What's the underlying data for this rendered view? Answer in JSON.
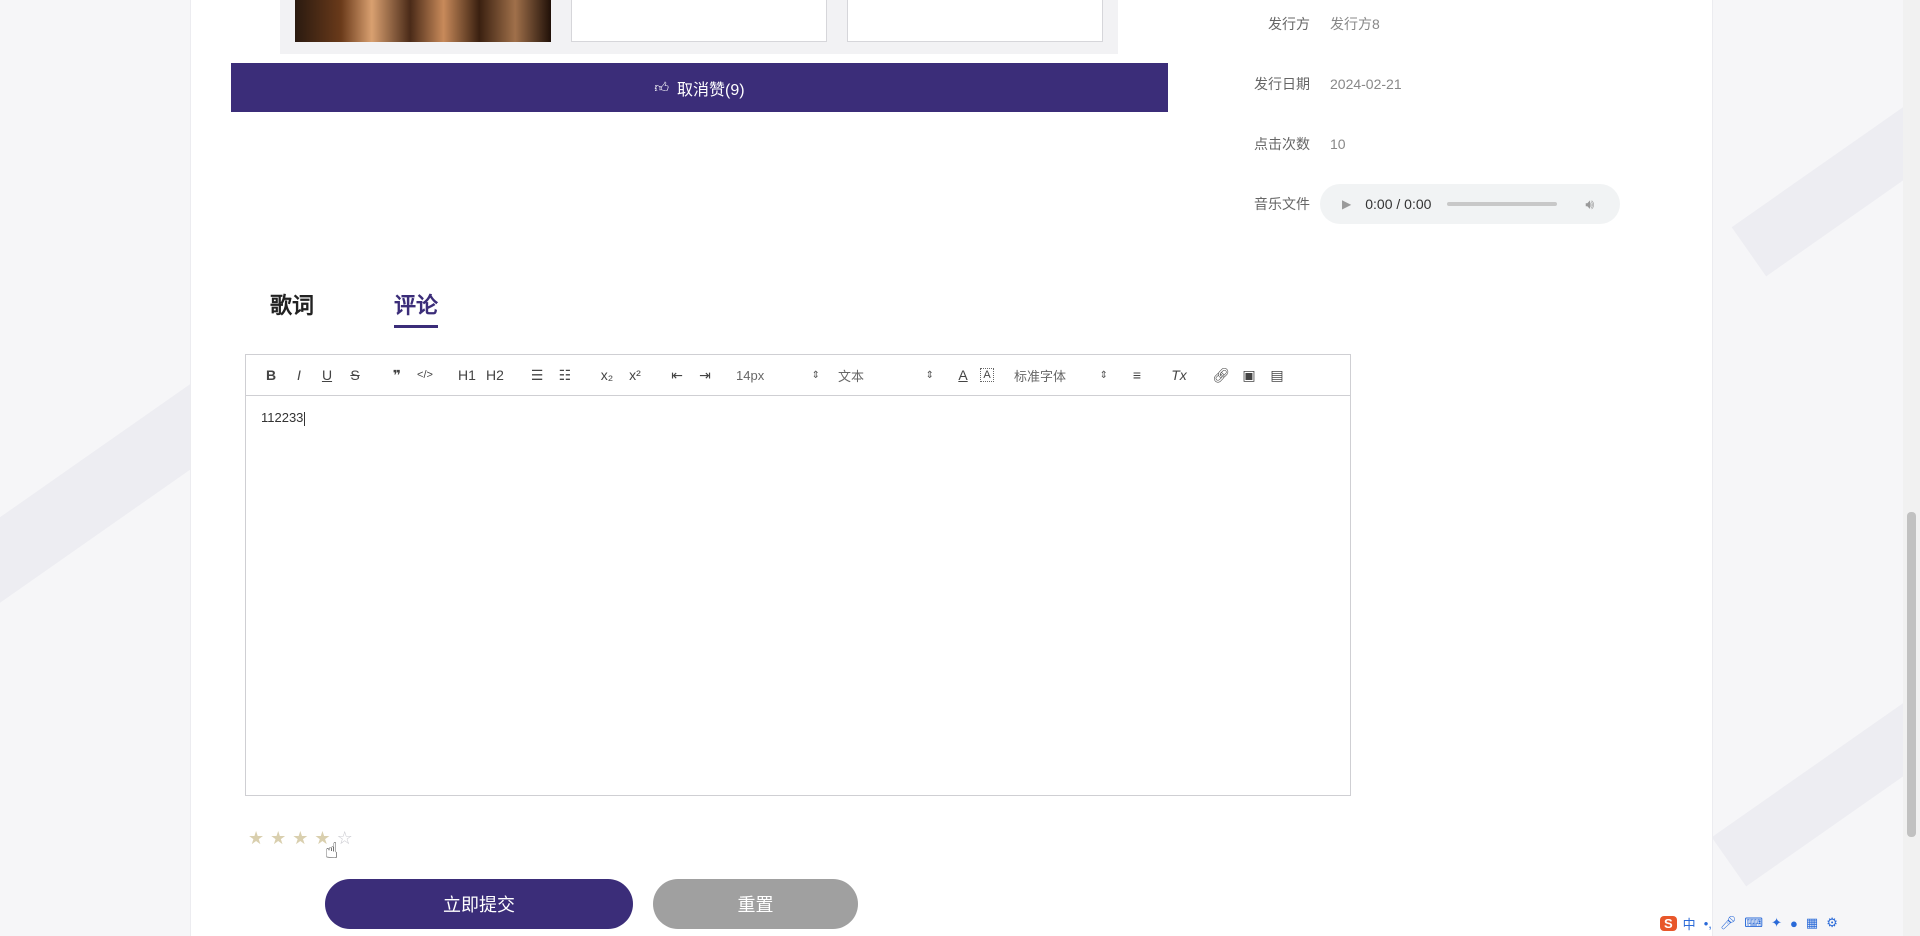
{
  "like": {
    "label": "取消赞(9)",
    "icon": "thumbs-up-icon"
  },
  "info": [
    {
      "label": "发行方",
      "value": "发行方8"
    },
    {
      "label": "发行日期",
      "value": "2024-02-21"
    },
    {
      "label": "点击次数",
      "value": "10"
    }
  ],
  "audio": {
    "label": "音乐文件",
    "time": "0:00 / 0:00"
  },
  "tabs": {
    "lyrics": "歌词",
    "comments": "评论"
  },
  "toolbar": {
    "font_size": "14px",
    "block_type": "文本",
    "font_family": "标准字体",
    "h1": "H1",
    "h2": "H2",
    "quote": "❞",
    "code": "</>",
    "sub": "x₂",
    "sup": "x²"
  },
  "editor": {
    "content": "112233"
  },
  "rating": {
    "value": 4,
    "max": 5
  },
  "buttons": {
    "submit": "立即提交",
    "reset": "重置"
  },
  "tray": {
    "ime": "中",
    "logo": "S"
  },
  "colors": {
    "accent": "#3b2d79",
    "reset": "#a0a0a0",
    "star": "#d9cfae"
  }
}
